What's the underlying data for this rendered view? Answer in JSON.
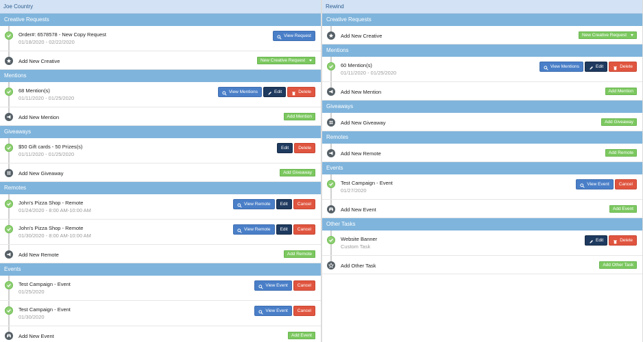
{
  "left": {
    "title": "Joe Country",
    "creative": {
      "header": "Creative Requests",
      "entry": {
        "title": "Order#: 6578578 - New Copy Request",
        "dates": "01/18/2020 - 02/22/2020",
        "view": "View Request"
      },
      "add": {
        "label": "Add New Creative",
        "button": "New Creative Request"
      }
    },
    "mentions": {
      "header": "Mentions",
      "entry": {
        "title": "68 Mention(s)",
        "dates": "01/11/2020 - 01/25/2020",
        "view": "View Mentions",
        "edit": "Edit",
        "delete": "Delete"
      },
      "add": {
        "label": "Add New Mention",
        "button": "Add Mention"
      }
    },
    "giveaways": {
      "header": "Giveaways",
      "entry": {
        "title": "$50 Gift cards - 50 Prizes(s)",
        "dates": "01/11/2020 - 01/25/2020",
        "edit": "Edit",
        "delete": "Delete"
      },
      "add": {
        "label": "Add New Giveaway",
        "button": "Add Giveaway"
      }
    },
    "remotes": {
      "header": "Remotes",
      "entries": [
        {
          "title": "John's Pizza Shop - Remote",
          "dates": "01/24/2020 - 8:00 AM-10:00 AM",
          "view": "View Remote",
          "edit": "Edit",
          "cancel": "Cancel"
        },
        {
          "title": "John's Pizza Shop - Remote",
          "dates": "01/30/2020 - 8:00 AM-10:00 AM",
          "view": "View Remote",
          "edit": "Edit",
          "cancel": "Cancel"
        }
      ],
      "add": {
        "label": "Add New Remote",
        "button": "Add Remote"
      }
    },
    "events": {
      "header": "Events",
      "entries": [
        {
          "title": "Test Campaign - Event",
          "dates": "01/25/2020",
          "view": "View Event",
          "cancel": "Cancel"
        },
        {
          "title": "Test Campaign - Event",
          "dates": "01/30/2020",
          "view": "View Event",
          "cancel": "Cancel"
        }
      ],
      "add": {
        "label": "Add New Event",
        "button": "Add Event"
      }
    }
  },
  "right": {
    "title": "Rewind",
    "creative": {
      "header": "Creative Requests",
      "add": {
        "label": "Add New Creative",
        "button": "New Creative Request"
      }
    },
    "mentions": {
      "header": "Mentions",
      "entry": {
        "title": "60 Mention(s)",
        "dates": "01/11/2020 - 01/25/2020",
        "view": "View Mentions",
        "edit": "Edit",
        "delete": "Delete"
      },
      "add": {
        "label": "Add New Mention",
        "button": "Add Mention"
      }
    },
    "giveaways": {
      "header": "Giveaways",
      "add": {
        "label": "Add New Giveaway",
        "button": "Add Giveaway"
      }
    },
    "remotes": {
      "header": "Remotes",
      "add": {
        "label": "Add New Remote",
        "button": "Add Remote"
      }
    },
    "events": {
      "header": "Events",
      "entry": {
        "title": "Test Campaign - Event",
        "dates": "01/27/2020",
        "view": "View Event",
        "cancel": "Cancel"
      },
      "add": {
        "label": "Add New Event",
        "button": "Add Event"
      }
    },
    "other": {
      "header": "Other Tasks",
      "entry": {
        "title": "Website Banner",
        "sub": "Custom Task",
        "edit": "Edit",
        "delete": "Delete"
      },
      "add": {
        "label": "Add Other Task",
        "button": "Add Other Task"
      }
    }
  },
  "colors": {
    "section": "#7fb4dc",
    "header": "#d3e3f5",
    "blue": "#4a7fc8",
    "navy": "#1f3a5f",
    "red": "#e0553f",
    "green": "#7cc860"
  }
}
